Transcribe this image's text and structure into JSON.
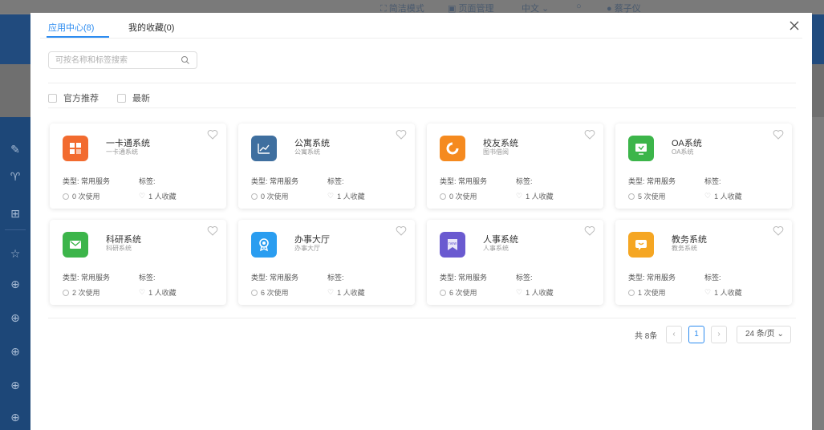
{
  "top_bar": {
    "simple_mode": "简洁模式",
    "page_manage": "页面管理",
    "language": "中文",
    "user_name": "蔡子仪"
  },
  "modal": {
    "tabs": [
      {
        "label": "应用中心(8)",
        "active": true
      },
      {
        "label": "我的收藏(0)",
        "active": false
      }
    ],
    "search": {
      "placeholder": "可按名称和标签搜索",
      "value": ""
    },
    "filters": [
      {
        "label": "官方推荐",
        "checked": false
      },
      {
        "label": "最新",
        "checked": false
      }
    ],
    "apps": [
      {
        "name": "一卡通系统",
        "subtitle": "一卡通系统",
        "type": "类型: 常用服务",
        "tag": "标签:",
        "usage": "0 次使用",
        "favorites": "1 人收藏",
        "icon": "card-icon",
        "color": "#f26b2f"
      },
      {
        "name": "公寓系统",
        "subtitle": "公寓系统",
        "type": "类型: 常用服务",
        "tag": "标签:",
        "usage": "0 次使用",
        "favorites": "1 人收藏",
        "icon": "chart-line-icon",
        "color": "#3f6f9f"
      },
      {
        "name": "校友系统",
        "subtitle": "图书借阅",
        "type": "类型: 常用服务",
        "tag": "标签:",
        "usage": "0 次使用",
        "favorites": "1 人收藏",
        "icon": "circle-c-icon",
        "color": "#f58a1f"
      },
      {
        "name": "OA系统",
        "subtitle": "OA系统",
        "type": "类型: 常用服务",
        "tag": "标签:",
        "usage": "5 次使用",
        "favorites": "1 人收藏",
        "icon": "monitor-icon",
        "color": "#3cb54a"
      },
      {
        "name": "科研系统",
        "subtitle": "科研系统",
        "type": "类型: 常用服务",
        "tag": "标签:",
        "usage": "2 次使用",
        "favorites": "1 人收藏",
        "icon": "mail-icon",
        "color": "#3cb54a"
      },
      {
        "name": "办事大厅",
        "subtitle": "办事大厅",
        "type": "类型: 常用服务",
        "tag": "标签:",
        "usage": "6 次使用",
        "favorites": "1 人收藏",
        "icon": "badge-icon",
        "color": "#2a9df0"
      },
      {
        "name": "人事系统",
        "subtitle": "人事系统",
        "type": "类型: 常用服务",
        "tag": "标签:",
        "usage": "6 次使用",
        "favorites": "1 人收藏",
        "icon": "new-bookmark-icon",
        "color": "#6a5ad0"
      },
      {
        "name": "教务系统",
        "subtitle": "教务系统",
        "type": "类型: 常用服务",
        "tag": "标签:",
        "usage": "1 次使用",
        "favorites": "1 人收藏",
        "icon": "message-icon",
        "color": "#f5a623"
      }
    ],
    "pagination": {
      "total": "共 8条",
      "current_page": "1",
      "page_size": "24 条/页"
    },
    "accent_color": "#2d8cf0"
  }
}
